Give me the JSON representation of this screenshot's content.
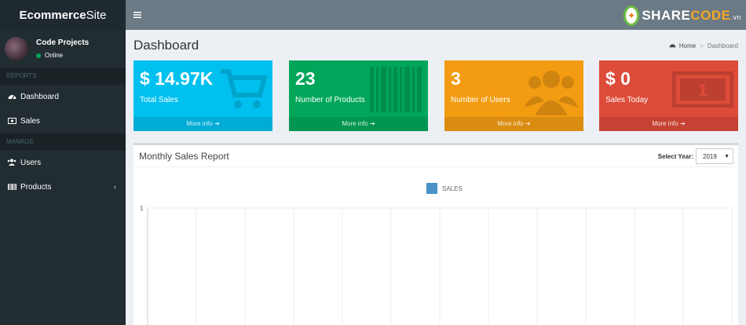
{
  "sidebar": {
    "logo_bold": "Ecommerce",
    "logo_light": "Site",
    "user_name": "Code Projects",
    "user_status": "Online",
    "section_reports": "REPORTS",
    "section_manage": "MANAGE",
    "items": {
      "dashboard": "Dashboard",
      "sales": "Sales",
      "users": "Users",
      "products": "Products"
    }
  },
  "topbar": {
    "brand_left": "SHARE",
    "brand_right": "CODE",
    "brand_suffix": ".vn"
  },
  "content": {
    "page_title": "Dashboard",
    "breadcrumb_home": "Home",
    "breadcrumb_current": "Dashboard"
  },
  "boxes": [
    {
      "value": "$ 14.97K",
      "label": "Total Sales",
      "footer": "More info",
      "color": "#00c0ef",
      "icon": "cart-icon"
    },
    {
      "value": "23",
      "label": "Number of Products",
      "footer": "More info",
      "color": "#00a65a",
      "icon": "barcode-icon"
    },
    {
      "value": "3",
      "label": "Number of Users",
      "footer": "More info",
      "color": "#f39c12",
      "icon": "users-icon"
    },
    {
      "value": "$ 0",
      "label": "Sales Today",
      "footer": "More info",
      "color": "#dd4b39",
      "icon": "money-icon"
    }
  ],
  "panel": {
    "title": "Monthly Sales Report",
    "select_label": "Select Year:",
    "select_value": "2019"
  },
  "chart_data": {
    "type": "bar",
    "series": [
      {
        "name": "SALES",
        "values": []
      }
    ],
    "legend": "top-center",
    "ytick_top": "1",
    "color": "#4a92c8",
    "grid": true
  }
}
